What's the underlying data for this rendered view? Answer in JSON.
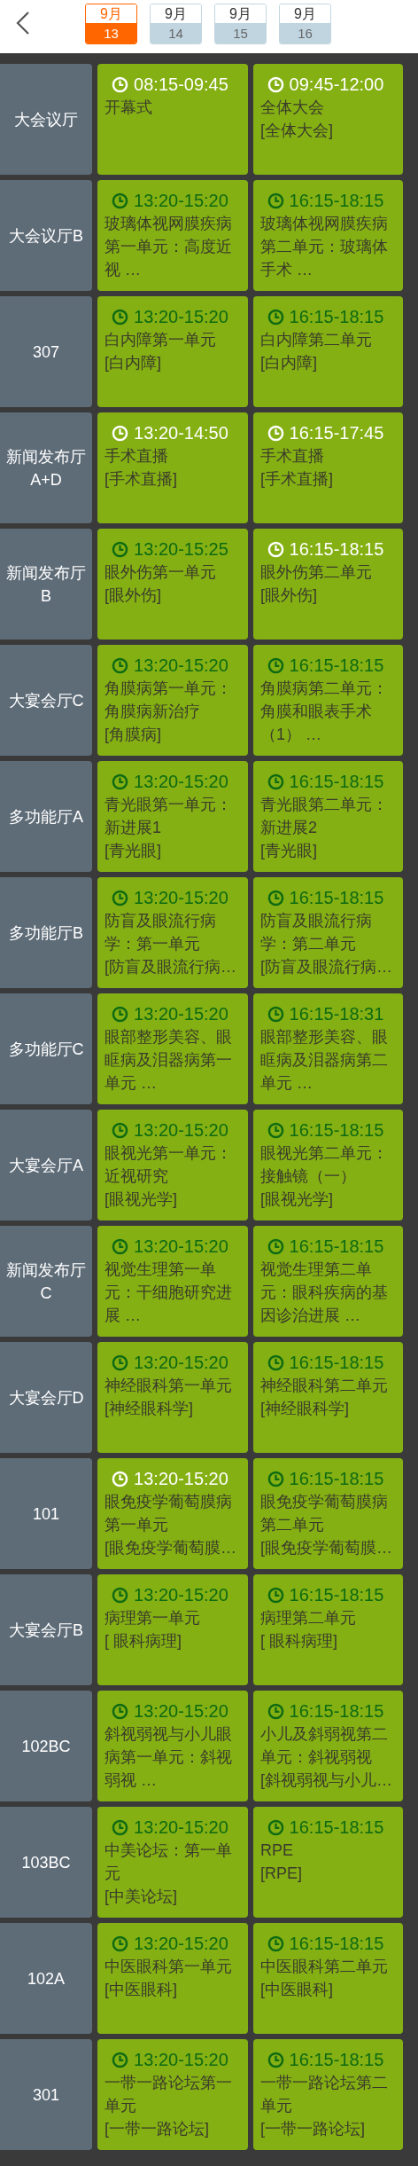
{
  "header": {
    "dates": [
      {
        "month": "9月",
        "day": "13",
        "selected": true
      },
      {
        "month": "9月",
        "day": "14",
        "selected": false
      },
      {
        "month": "9月",
        "day": "15",
        "selected": false
      },
      {
        "month": "9月",
        "day": "16",
        "selected": false
      }
    ]
  },
  "rooms": [
    {
      "name": "大会议厅",
      "sessions": [
        {
          "time": "08:15-09:45",
          "highlight": true,
          "title": "开幕式"
        },
        {
          "time": "09:45-12:00",
          "highlight": true,
          "title": "全体大会",
          "track": "[全体大会]"
        }
      ]
    },
    {
      "name": "大会议厅B",
      "sessions": [
        {
          "time": "13:20-15:20",
          "highlight": false,
          "title": "玻璃体视网膜疾病第一单元：高度近视 …"
        },
        {
          "time": "16:15-18:15",
          "highlight": false,
          "title": "玻璃体视网膜疾病第二单元：玻璃体手术 …"
        }
      ]
    },
    {
      "name": "307",
      "sessions": [
        {
          "time": "13:20-15:20",
          "highlight": false,
          "title": "白内障第一单元",
          "track": "[白内障]"
        },
        {
          "time": "16:15-18:15",
          "highlight": false,
          "title": "白内障第二单元",
          "track": "[白内障]"
        }
      ]
    },
    {
      "name": "新闻发布厅A+D",
      "sessions": [
        {
          "time": "13:20-14:50",
          "highlight": true,
          "title": "手术直播",
          "track": "[手术直播]"
        },
        {
          "time": "16:15-17:45",
          "highlight": true,
          "title": "手术直播",
          "track": "[手术直播]"
        }
      ]
    },
    {
      "name": "新闻发布厅B",
      "sessions": [
        {
          "time": "13:20-15:25",
          "highlight": false,
          "title": "眼外伤第一单元",
          "track": "[眼外伤]"
        },
        {
          "time": "16:15-18:15",
          "highlight": true,
          "title": "眼外伤第二单元",
          "track": "[眼外伤]"
        }
      ]
    },
    {
      "name": "大宴会厅C",
      "sessions": [
        {
          "time": "13:20-15:20",
          "highlight": false,
          "title": "角膜病第一单元：角膜病新治疗",
          "track": "[角膜病]"
        },
        {
          "time": "16:15-18:15",
          "highlight": false,
          "title": "角膜病第二单元：角膜和眼表手术（1） …"
        }
      ]
    },
    {
      "name": "多功能厅A",
      "sessions": [
        {
          "time": "13:20-15:20",
          "highlight": false,
          "title": "青光眼第一单元：新进展1",
          "track": "[青光眼]"
        },
        {
          "time": "16:15-18:15",
          "highlight": false,
          "title": "青光眼第二单元：新进展2",
          "track": "[青光眼]"
        }
      ]
    },
    {
      "name": "多功能厅B",
      "sessions": [
        {
          "time": "13:20-15:20",
          "highlight": false,
          "title": "防盲及眼流行病学：第一单元",
          "track": "[防盲及眼流行病…"
        },
        {
          "time": "16:15-18:15",
          "highlight": false,
          "title": "防盲及眼流行病学：第二单元",
          "track": "[防盲及眼流行病…"
        }
      ]
    },
    {
      "name": "多功能厅C",
      "sessions": [
        {
          "time": "13:20-15:20",
          "highlight": false,
          "title": "眼部整形美容、眼眶病及泪器病第一单元 …"
        },
        {
          "time": "16:15-18:31",
          "highlight": false,
          "title": "眼部整形美容、眼眶病及泪器病第二单元 …"
        }
      ]
    },
    {
      "name": "大宴会厅A",
      "sessions": [
        {
          "time": "13:20-15:20",
          "highlight": false,
          "title": "眼视光第一单元：近视研究",
          "track": "[眼视光学]"
        },
        {
          "time": "16:15-18:15",
          "highlight": false,
          "title": "眼视光第二单元：接触镜（一）",
          "track": "[眼视光学]"
        }
      ]
    },
    {
      "name": "新闻发布厅C",
      "sessions": [
        {
          "time": "13:20-15:20",
          "highlight": false,
          "title": "视觉生理第一单元：干细胞研究进展 …"
        },
        {
          "time": "16:15-18:15",
          "highlight": false,
          "title": "视觉生理第二单元：眼科疾病的基因诊治进展 …"
        }
      ]
    },
    {
      "name": "大宴会厅D",
      "sessions": [
        {
          "time": "13:20-15:20",
          "highlight": false,
          "title": "神经眼科第一单元",
          "track": "[神经眼科学]"
        },
        {
          "time": "16:15-18:15",
          "highlight": false,
          "title": "神经眼科第二单元",
          "track": "[神经眼科学]"
        }
      ]
    },
    {
      "name": "101",
      "sessions": [
        {
          "time": "13:20-15:20",
          "highlight": true,
          "title": "眼免疫学葡萄膜病第一单元",
          "track": "[眼免疫学葡萄膜…"
        },
        {
          "time": "16:15-18:15",
          "highlight": false,
          "title": "眼免疫学葡萄膜病第二单元",
          "track": "[眼免疫学葡萄膜…"
        }
      ]
    },
    {
      "name": "大宴会厅B",
      "sessions": [
        {
          "time": "13:20-15:20",
          "highlight": false,
          "title": "病理第一单元",
          "track": "[ 眼科病理]"
        },
        {
          "time": "16:15-18:15",
          "highlight": false,
          "title": "病理第二单元",
          "track": "[ 眼科病理]"
        }
      ]
    },
    {
      "name": "102BC",
      "sessions": [
        {
          "time": "13:20-15:20",
          "highlight": false,
          "title": "斜视弱视与小儿眼病第一单元：斜视弱视 …"
        },
        {
          "time": "16:15-18:15",
          "highlight": false,
          "title": "小儿及斜弱视第二单元：斜视弱视",
          "track": "[斜视弱视与小儿…"
        }
      ]
    },
    {
      "name": "103BC",
      "sessions": [
        {
          "time": "13:20-15:20",
          "highlight": false,
          "title": "中美论坛：第一单元",
          "track": "[中美论坛]"
        },
        {
          "time": "16:15-18:15",
          "highlight": false,
          "title": "RPE",
          "track": "[RPE]"
        }
      ]
    },
    {
      "name": "102A",
      "sessions": [
        {
          "time": "13:20-15:20",
          "highlight": false,
          "title": "中医眼科第一单元",
          "track": "[中医眼科]"
        },
        {
          "time": "16:15-18:15",
          "highlight": false,
          "title": "中医眼科第二单元",
          "track": "[中医眼科]"
        }
      ]
    },
    {
      "name": "301",
      "sessions": [
        {
          "time": "13:20-15:20",
          "highlight": false,
          "title": "一带一路论坛第一单元",
          "track": "[一带一路论坛]"
        },
        {
          "time": "16:15-18:15",
          "highlight": false,
          "title": "一带一路论坛第二单元",
          "track": "[一带一路论坛]"
        }
      ]
    }
  ]
}
